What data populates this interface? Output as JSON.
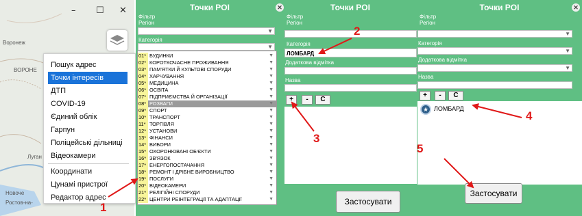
{
  "map": {
    "labels": [
      "Воронеж",
      "ВОРОНЕ",
      "Луган",
      "Новоче",
      "Ростов-на-"
    ],
    "window_controls": {
      "minimize": "–",
      "maximize": "☐",
      "close": "✕"
    }
  },
  "menu": {
    "items": [
      "Пошук адрес",
      "Точки інтересів",
      "ДТП",
      "COVID-19",
      "Єдиний облік",
      "Гарпун",
      "Поліцейські дільниці",
      "Відеокамери"
    ],
    "items2": [
      "Координати",
      "Цунамі пристрої",
      "Редактор адрес"
    ],
    "selected": "Точки інтересів"
  },
  "poi": {
    "title": "Точки POI",
    "filter_label": "Фільтр",
    "region_label": "Регіон",
    "category_label": "Категорія",
    "extra_label": "Додаткова відмітка",
    "name_label": "Назва",
    "category_value": "ЛОМБАРД",
    "plus": "+",
    "minus": "-",
    "clear": "C",
    "apply": "Застосувати",
    "result_item": "ЛОМБАРД"
  },
  "categories": [
    {
      "code": "01*",
      "name": "БУДИНКИ"
    },
    {
      "code": "02*",
      "name": "КОРОТКОЧАСНЕ ПРОЖИВАННЯ"
    },
    {
      "code": "03*",
      "name": "ПАМ'ЯТКИ Й КУЛЬТОВІ СПОРУДИ"
    },
    {
      "code": "04*",
      "name": "ХАРЧУВАННЯ"
    },
    {
      "code": "05*",
      "name": "МЕДИЦИНА"
    },
    {
      "code": "06*",
      "name": "ОСВІТА"
    },
    {
      "code": "07*",
      "name": "ПІДПРИЄМСТВА Й ОРГАНІЗАЦІЇ"
    },
    {
      "code": "08*",
      "name": "РОЗВАГИ"
    },
    {
      "code": "09*",
      "name": "СПОРТ"
    },
    {
      "code": "10*",
      "name": "ТРАНСПОРТ"
    },
    {
      "code": "11*",
      "name": "ТОРГІВЛЯ"
    },
    {
      "code": "12*",
      "name": "УСТАНОВИ"
    },
    {
      "code": "13*",
      "name": "ФІНАНСИ"
    },
    {
      "code": "14*",
      "name": "ВИБОРИ"
    },
    {
      "code": "15*",
      "name": "ОХОРОНЮВАНІ ОБ'ЄКТИ"
    },
    {
      "code": "16*",
      "name": "ЗВ'ЯЗОК"
    },
    {
      "code": "17*",
      "name": "ЕНЕРГОПОСТАЧАННЯ"
    },
    {
      "code": "18*",
      "name": "РЕМОНТ І ДРІБНЕ ВИРОБНИЦТВО"
    },
    {
      "code": "19*",
      "name": "ПОСЛУГИ"
    },
    {
      "code": "20*",
      "name": "ВІДЕОКАМЕРИ"
    },
    {
      "code": "21*",
      "name": "РЕЛІГІЙНІ СПОРУДИ"
    },
    {
      "code": "22*",
      "name": "ЦЕНТРИ РЕІНТЕГРАЦІЇ ТА АДАПТАЦІЇ"
    }
  ],
  "highlighted_category": "08*",
  "annotations": [
    "1",
    "2",
    "3",
    "4",
    "5"
  ],
  "colors": {
    "panel_green": "#5fbf83",
    "menu_select": "#1a73d9",
    "annotation_red": "#e01818",
    "code_yellow": "#f8f59a"
  }
}
